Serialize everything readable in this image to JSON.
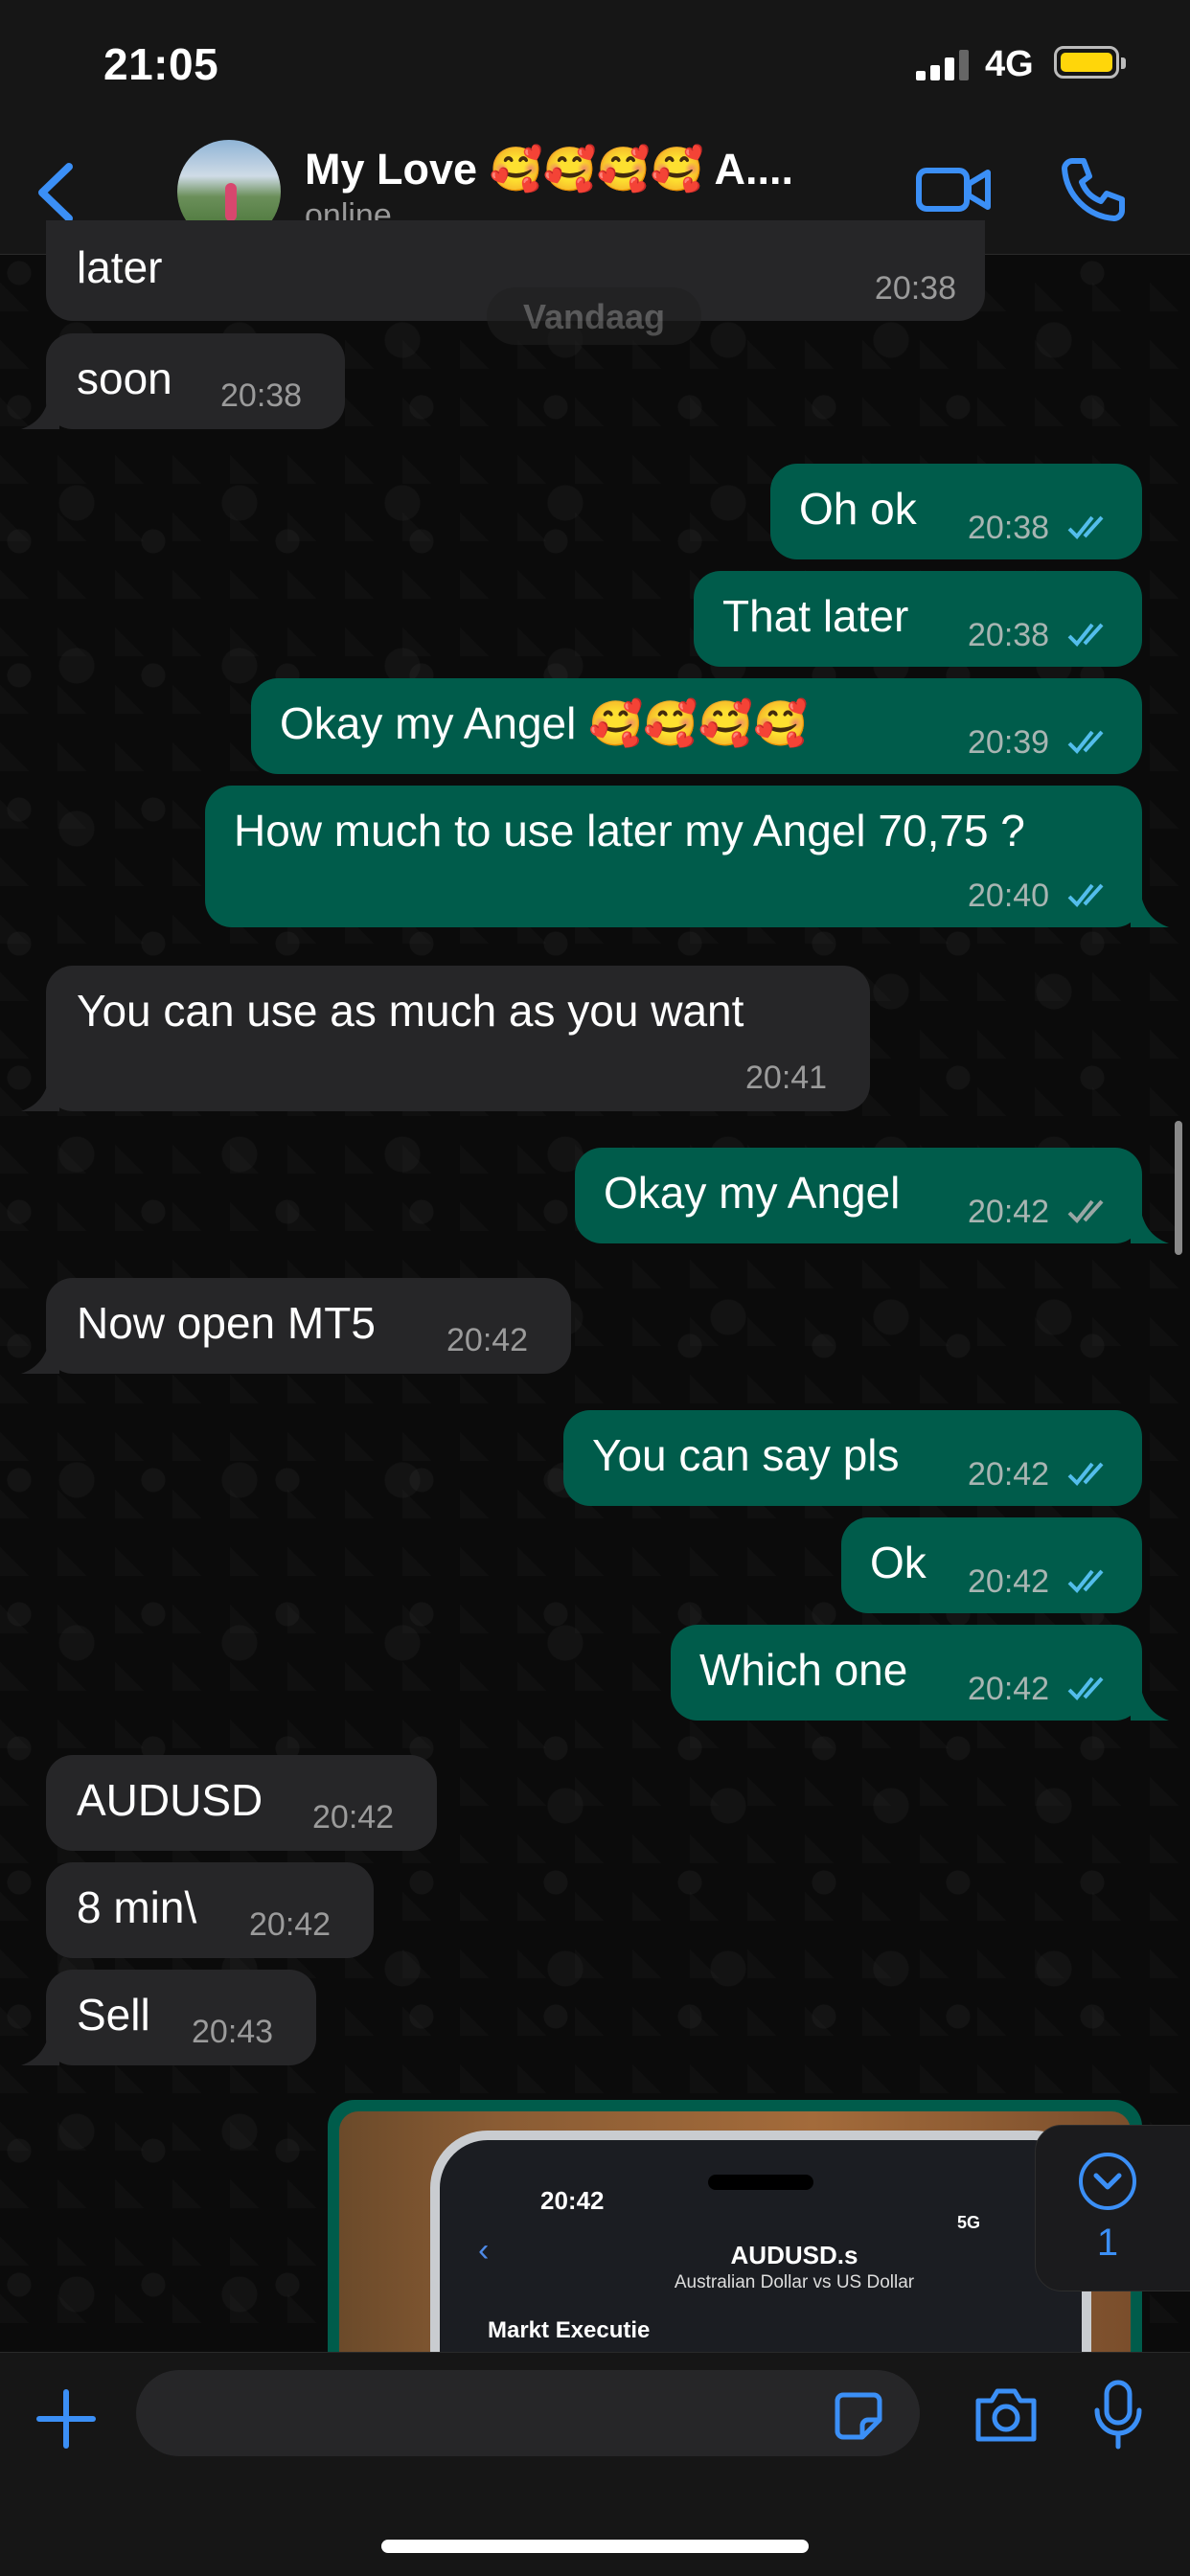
{
  "status_bar": {
    "time": "21:05",
    "network": "4G"
  },
  "header": {
    "contact_name": "My Love 🥰🥰🥰🥰 A....",
    "contact_status": "online"
  },
  "date_separator": "Vandaag",
  "messages": [
    {
      "dir": "in",
      "text": "later",
      "time": "20:38"
    },
    {
      "dir": "in",
      "text": "soon",
      "time": "20:38"
    },
    {
      "dir": "out",
      "text": "Oh ok",
      "time": "20:38",
      "status": "read"
    },
    {
      "dir": "out",
      "text": "That later",
      "time": "20:38",
      "status": "read"
    },
    {
      "dir": "out",
      "text": "Okay my Angel 🥰🥰🥰🥰",
      "time": "20:39",
      "status": "read"
    },
    {
      "dir": "out",
      "text": "How much to use later my Angel 70,75 ?",
      "time": "20:40",
      "status": "read"
    },
    {
      "dir": "in",
      "text": "You can use as much as you want",
      "time": "20:41"
    },
    {
      "dir": "out",
      "text": "Okay my Angel",
      "time": "20:42",
      "status": "delivered"
    },
    {
      "dir": "in",
      "text": "Now open MT5",
      "time": "20:42"
    },
    {
      "dir": "out",
      "text": "You can say pls",
      "time": "20:42",
      "status": "read"
    },
    {
      "dir": "out",
      "text": "Ok",
      "time": "20:42",
      "status": "read"
    },
    {
      "dir": "out",
      "text": "Which one",
      "time": "20:42",
      "status": "read"
    },
    {
      "dir": "in",
      "text": "AUDUSD",
      "time": "20:42"
    },
    {
      "dir": "in",
      "text": "8 min\\",
      "time": "20:42"
    },
    {
      "dir": "in",
      "text": "Sell",
      "time": "20:43"
    }
  ],
  "image_message": {
    "phone_time": "20:42",
    "phone_network": "5G",
    "symbol": "AUDUSD.s",
    "symbol_desc": "Australian Dollar vs US Dollar",
    "mode": "Markt Executie"
  },
  "scroll_button": {
    "unread_count": "1"
  },
  "composer": {
    "placeholder": ""
  },
  "colors": {
    "accent": "#3b8ff6",
    "outgoing_bubble": "#005c4b",
    "incoming_bubble": "#262628",
    "read_tick": "#53bdeb"
  }
}
